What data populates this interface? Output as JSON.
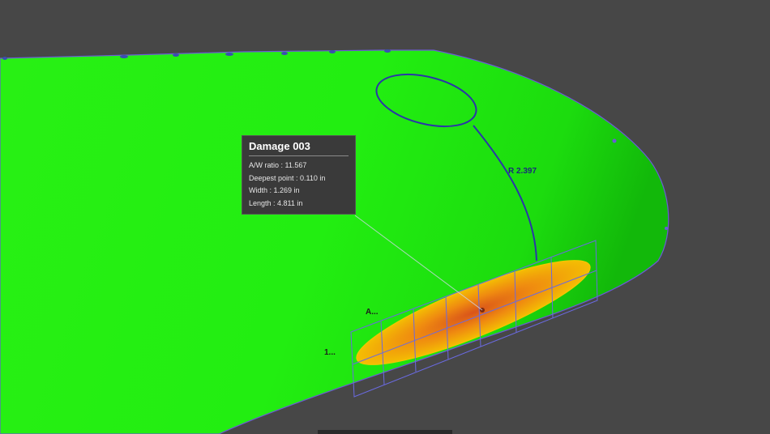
{
  "damage_tooltip": {
    "title": "Damage 003",
    "rows": [
      {
        "label": "A/W ratio : 11.567"
      },
      {
        "label": "Deepest point : 0.110 in"
      },
      {
        "label": "Width : 1.269 in"
      },
      {
        "label": "Length : 4.811 in"
      }
    ]
  },
  "annotations": {
    "radius_label": "R 2.397",
    "grid_label_a": "A...",
    "grid_label_1": "1..."
  },
  "colors": {
    "background": "#474747",
    "surface": "#22ee11",
    "damage_inner": "#e87a10",
    "damage_outer": "#f2c400",
    "grid": "#6a6ae0",
    "curve": "#2a36a8"
  }
}
